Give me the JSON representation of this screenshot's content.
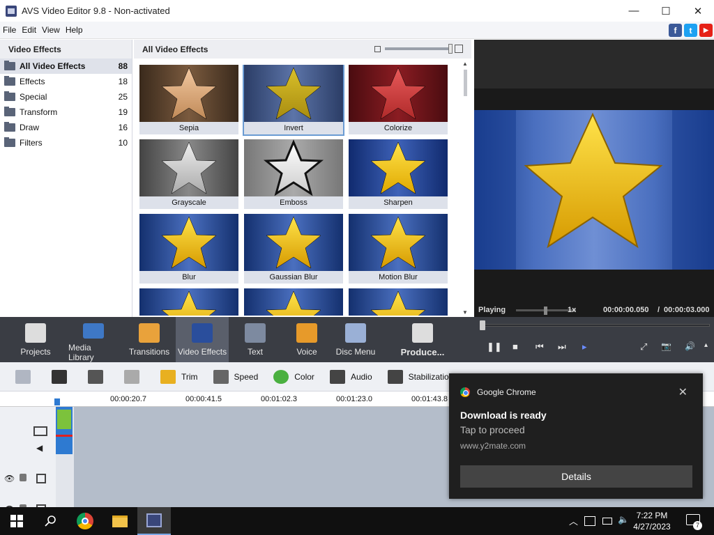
{
  "window": {
    "title": "AVS Video Editor 9.8 - Non-activated",
    "minimize": "—",
    "maximize": "☐",
    "close": "✕"
  },
  "menu": [
    "File",
    "Edit",
    "View",
    "Help"
  ],
  "social": [
    {
      "icon": "facebook-icon",
      "glyph": "f",
      "color": "#3b5998"
    },
    {
      "icon": "twitter-icon",
      "glyph": "t",
      "color": "#1da1f2"
    },
    {
      "icon": "youtube-icon",
      "glyph": "▶",
      "color": "#e62117"
    }
  ],
  "left_panel": {
    "title": "Video Effects",
    "categories": [
      {
        "label": "All Video Effects",
        "count": "88",
        "selected": true
      },
      {
        "label": "Effects",
        "count": "18"
      },
      {
        "label": "Special",
        "count": "25"
      },
      {
        "label": "Transform",
        "count": "19"
      },
      {
        "label": "Draw",
        "count": "16"
      },
      {
        "label": "Filters",
        "count": "10"
      }
    ]
  },
  "effects_panel": {
    "title": "All Video Effects",
    "effects": [
      "Sepia",
      "Invert",
      "Colorize",
      "Grayscale",
      "Emboss",
      "Sharpen",
      "Blur",
      "Gaussian Blur",
      "Motion Blur",
      "",
      "",
      ""
    ],
    "selected": "Invert"
  },
  "preview": {
    "status": "Playing",
    "speed": "1x",
    "current_time": "00:00:00.050",
    "separator": "/",
    "total_time": "00:00:03.000"
  },
  "toolbar": [
    {
      "label": "Projects",
      "icon": "clapperboard-icon"
    },
    {
      "label": "Media Library",
      "icon": "film-strip-icon"
    },
    {
      "label": "Transitions",
      "icon": "transitions-icon"
    },
    {
      "label": "Video Effects",
      "icon": "star-effects-icon",
      "active": true
    },
    {
      "label": "Text",
      "icon": "text-t-icon"
    },
    {
      "label": "Voice",
      "icon": "microphone-icon"
    },
    {
      "label": "Disc Menu",
      "icon": "disc-icon"
    },
    {
      "label": "Produce...",
      "icon": "produce-clapper-icon"
    }
  ],
  "playback": {
    "pause": "❚❚",
    "stop": "■",
    "prev": "⏮",
    "next": "⏭",
    "frames": "▸",
    "fullscreen": "⤢",
    "snapshot": "📷",
    "volume": "🔊",
    "menu": "▴"
  },
  "edit_tools": [
    {
      "label": "",
      "icon": "storyboard-icon"
    },
    {
      "label": "",
      "icon": "delete-x-icon"
    },
    {
      "label": "",
      "icon": "undo-icon"
    },
    {
      "label": "",
      "icon": "redo-icon"
    },
    {
      "label": "Trim",
      "icon": "trim-icon"
    },
    {
      "label": "Speed",
      "icon": "speed-icon"
    },
    {
      "label": "Color",
      "icon": "color-wheel-icon"
    },
    {
      "label": "Audio",
      "icon": "music-note-icon"
    },
    {
      "label": "Stabilization",
      "icon": "stabilization-icon"
    }
  ],
  "timeline": {
    "ruler": [
      "00:00:20.7",
      "00:00:41.5",
      "00:01:02.3",
      "00:01:23.0",
      "00:01:43.8"
    ]
  },
  "notification": {
    "app": "Google Chrome",
    "title": "Download is ready",
    "subtitle": "Tap to proceed",
    "source": "www.y2mate.com",
    "button": "Details",
    "close": "✕"
  },
  "taskbar": {
    "time": "7:22 PM",
    "date": "4/27/2023",
    "notif_count": "7"
  }
}
